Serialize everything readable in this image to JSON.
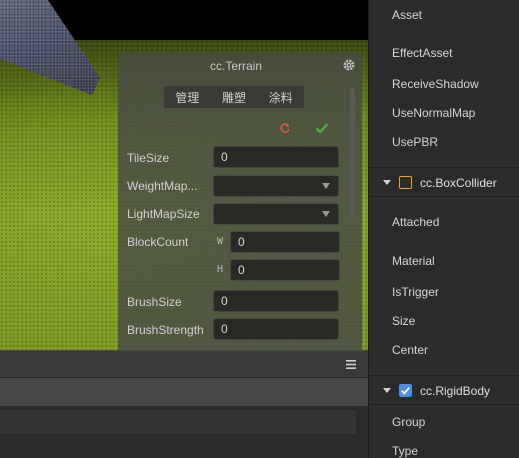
{
  "terrain_panel": {
    "title": "cc.Terrain",
    "tabs": [
      "管理",
      "雕塑",
      "涂料"
    ],
    "props": {
      "tile_size": {
        "label": "TileSize",
        "value": "0"
      },
      "weight_map": {
        "label": "WeightMap..."
      },
      "light_map_size": {
        "label": "LightMapSize"
      },
      "block_count": {
        "label": "BlockCount",
        "w_label": "W",
        "w_value": "0",
        "h_label": "H",
        "h_value": "0"
      },
      "brush_size": {
        "label": "BrushSize",
        "value": "0"
      },
      "brush_strength": {
        "label": "BrushStrength",
        "value": "0"
      }
    }
  },
  "inspector": {
    "items_top": [
      "Asset",
      "EffectAsset",
      "ReceiveShadow",
      "UseNormalMap",
      "UsePBR"
    ],
    "box_collider": {
      "name": "cc.BoxCollider",
      "checked": false,
      "checkbox_color": "#e6a23c",
      "items": [
        "Attached",
        "Material",
        "IsTrigger",
        "Size",
        "Center"
      ]
    },
    "rigid_body": {
      "name": "cc.RigidBody",
      "checked": true,
      "checkbox_color": "#4a8fe0",
      "items": [
        "Group",
        "Type"
      ]
    }
  },
  "icons": {
    "gear": "gear-icon",
    "reset": "reset-icon",
    "confirm": "checkmark-icon",
    "menu": "hamburger-menu-icon"
  },
  "colors": {
    "reset_icon": "#d9534f",
    "confirm_icon": "#4caf50"
  }
}
